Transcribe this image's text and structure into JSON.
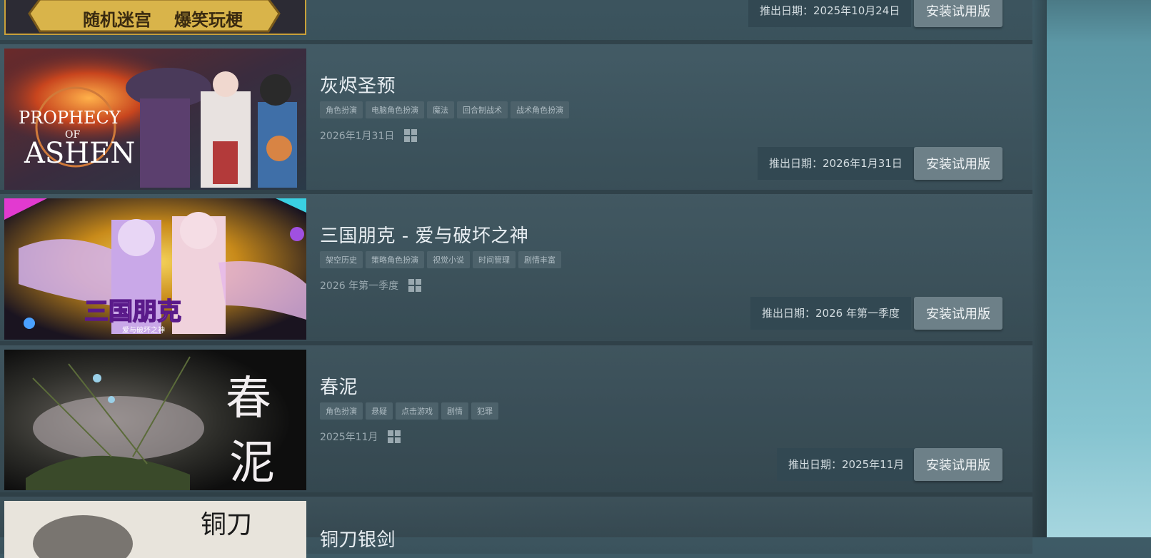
{
  "games": [
    {
      "id": "top-partial",
      "title": "",
      "tags": [],
      "date": "",
      "release_label": "推出日期：2025年10月24日",
      "install_label": "安装试用版",
      "capsule_text": [
        "随机迷宫",
        "爆笑玩梗"
      ]
    },
    {
      "id": "prophecy",
      "title": "灰烬圣预",
      "tags": [
        "角色扮演",
        "电脑角色扮演",
        "魔法",
        "回合制战术",
        "战术角色扮演"
      ],
      "date": "2026年1月31日",
      "release_label": "推出日期：2026年1月31日",
      "install_label": "安装试用版",
      "capsule_text": [
        "PROPHECY",
        "OF",
        "ASHEN"
      ]
    },
    {
      "id": "sanguo",
      "title": "三国朋克 - 爱与破坏之神",
      "tags": [
        "架空历史",
        "策略角色扮演",
        "视觉小说",
        "时间管理",
        "剧情丰富"
      ],
      "date": "2026 年第一季度",
      "release_label": "推出日期：2026 年第一季度",
      "install_label": "安装试用版",
      "capsule_text": [
        "三国朋克",
        "爱与破坏之神"
      ]
    },
    {
      "id": "chunni",
      "title": "春泥",
      "tags": [
        "角色扮演",
        "悬疑",
        "点击游戏",
        "剧情",
        "犯罪"
      ],
      "date": "2025年11月",
      "release_label": "推出日期：2025年11月",
      "install_label": "安装试用版",
      "capsule_text": [
        "春",
        "泥"
      ]
    },
    {
      "id": "bottom-partial",
      "title": "铜刀银剑",
      "capsule_text": [
        "铜刀"
      ]
    }
  ],
  "colors": {
    "tag_bg": "#4d626b",
    "button_bg": "#6d8088",
    "pill_bg": "#324852",
    "right_panel": "#6aabba"
  },
  "icons": {
    "platform": "windows-icon"
  }
}
